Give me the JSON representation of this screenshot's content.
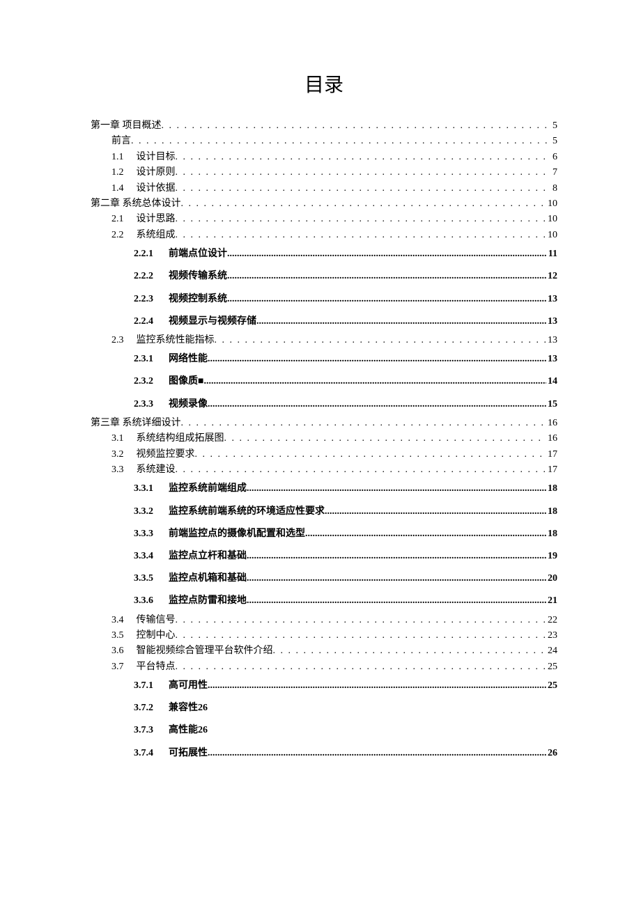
{
  "title": "目录",
  "entries": [
    {
      "level": 0,
      "num": "",
      "text": "第一章 项目概述",
      "page": "5"
    },
    {
      "level": 1,
      "num": "",
      "text": "前言",
      "page": "5"
    },
    {
      "level": 2,
      "num": "1.1",
      "text": "设计目标",
      "page": "6"
    },
    {
      "level": 2,
      "num": "1.2",
      "text": "设计原则",
      "page": "7"
    },
    {
      "level": 2,
      "num": "1.4",
      "text": "设计依据",
      "page": "8"
    },
    {
      "level": 0,
      "num": "",
      "text": "第二章 系统总体设计",
      "page": "10"
    },
    {
      "level": 2,
      "num": "2.1",
      "text": "设计思路",
      "page": "10"
    },
    {
      "level": 2,
      "num": "2.2",
      "text": "系统组成",
      "page": "10"
    },
    {
      "level": 3,
      "num": "2.2.1",
      "text": "前端点位设计",
      "page": "11"
    },
    {
      "level": 3,
      "num": "2.2.2",
      "text": "视频传输系统",
      "page": "12"
    },
    {
      "level": 3,
      "num": "2.2.3",
      "text": "视频控制系统",
      "page": "13"
    },
    {
      "level": 3,
      "num": "2.2.4",
      "text": "视频显示与视频存储",
      "page": "13"
    },
    {
      "level": 2,
      "num": "2.3",
      "text": "监控系统性能指标",
      "page": "13"
    },
    {
      "level": 3,
      "num": "2.3.1",
      "text": "网络性能",
      "page": "13"
    },
    {
      "level": 3,
      "num": "2.3.2",
      "text": "图像质■",
      "page": "14"
    },
    {
      "level": 3,
      "num": "2.3.3",
      "text": "视频录像",
      "page": "15"
    },
    {
      "level": 0,
      "num": "",
      "text": "第三章 系统详细设计",
      "page": "16"
    },
    {
      "level": 2,
      "num": "3.1",
      "text": "系统结构组成拓展图",
      "page": "16"
    },
    {
      "level": 2,
      "num": "3.2",
      "text": "视频监控要求",
      "page": "17"
    },
    {
      "level": 2,
      "num": "3.3",
      "text": "系统建设",
      "page": "17"
    },
    {
      "level": 3,
      "num": "3.3.1",
      "text": "监控系统前端组成",
      "page": "18"
    },
    {
      "level": 3,
      "num": "3.3.2",
      "text": "监控系统前端系统的环境适应性要求",
      "page": "18"
    },
    {
      "level": 3,
      "num": "3.3.3",
      "text": "前端监控点的摄像机配置和选型",
      "page": "18"
    },
    {
      "level": 3,
      "num": "3.3.4",
      "text": "监控点立杆和基础",
      "page": "19"
    },
    {
      "level": 3,
      "num": "3.3.5",
      "text": "监控点机箱和基础",
      "page": "20"
    },
    {
      "level": 3,
      "num": "3.3.6",
      "text": "监控点防雷和接地",
      "page": "21"
    },
    {
      "level": 2,
      "num": "3.4",
      "text": "传输信号",
      "page": "22"
    },
    {
      "level": 2,
      "num": "3.5",
      "text": "控制中心",
      "page": "23"
    },
    {
      "level": 2,
      "num": "3.6",
      "text": "智能视频综合管理平台软件介绍",
      "page": "24"
    },
    {
      "level": 2,
      "num": "3.7",
      "text": "平台特点",
      "page": "25"
    },
    {
      "level": 3,
      "num": "3.7.1",
      "text": "高可用性",
      "page": "25"
    },
    {
      "level": 3,
      "num": "3.7.2",
      "text": "兼容性26",
      "page": "",
      "noleader": true
    },
    {
      "level": 3,
      "num": "3.7.3",
      "text": "高性能26",
      "page": "",
      "noleader": true
    },
    {
      "level": 3,
      "num": "3.7.4",
      "text": "可拓展性",
      "page": "26"
    }
  ]
}
